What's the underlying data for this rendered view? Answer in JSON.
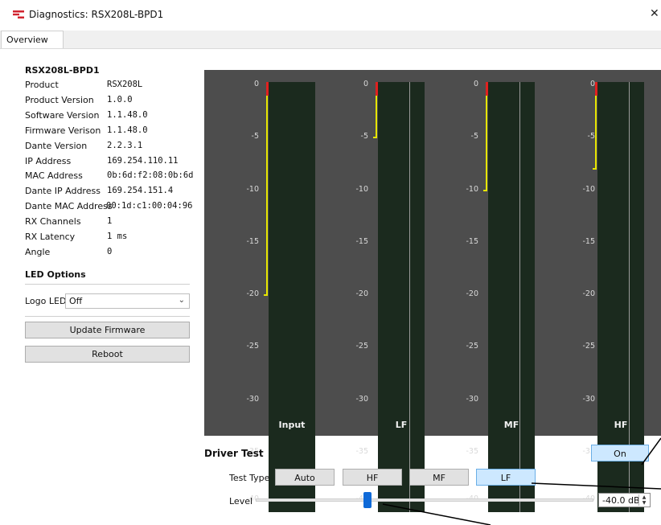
{
  "window": {
    "title": "Diagnostics: RSX208L-BPD1",
    "close_glyph": "✕",
    "accent": "#d1242f"
  },
  "tabs": [
    {
      "label": "Overview"
    }
  ],
  "info": {
    "heading": "RSX208L-BPD1",
    "rows": [
      {
        "label": "Product",
        "value": "RSX208L"
      },
      {
        "label": "Product Version",
        "value": "1.0.0"
      },
      {
        "label": "Software Version",
        "value": "1.1.48.0"
      },
      {
        "label": "Firmware Verison",
        "value": "1.1.48.0"
      },
      {
        "label": "Dante Version",
        "value": "2.2.3.1"
      },
      {
        "label": "IP Address",
        "value": "169.254.110.11"
      },
      {
        "label": "MAC Address",
        "value": "0b:6d:f2:08:0b:6d"
      },
      {
        "label": "Dante IP Address",
        "value": "169.254.151.4"
      },
      {
        "label": "Dante MAC Address",
        "value": "00:1d:c1:00:04:96"
      },
      {
        "label": "RX Channels",
        "value": "1"
      },
      {
        "label": "RX Latency",
        "value": "1 ms"
      },
      {
        "label": "Angle",
        "value": "0"
      }
    ],
    "led_heading": "LED Options",
    "logo_led_label": "Logo LED",
    "logo_led_value": "Off"
  },
  "buttons": {
    "update_firmware": "Update Firmware",
    "reboot": "Reboot"
  },
  "meters": {
    "tick_labels": [
      "0",
      "-5",
      "-10",
      "-15",
      "-20",
      "-25",
      "-30",
      "-35",
      "-40"
    ],
    "channels": [
      {
        "label": "Input",
        "peak_db": -20
      },
      {
        "label": "LF",
        "peak_db": -5
      },
      {
        "label": "MF",
        "peak_db": -10
      },
      {
        "label": "HF",
        "peak_db": -8
      }
    ],
    "colors": {
      "background": "#4d4d4d",
      "bar": "#1b2a1e",
      "level": "#e6e600",
      "clip": "#e02020"
    }
  },
  "driver_test": {
    "title": "Driver Test",
    "on_label": "On",
    "test_type_label": "Test Type",
    "test_types": [
      "Auto",
      "HF",
      "MF",
      "LF"
    ],
    "selected_type": "LF",
    "level_label": "Level",
    "level_value": "-40.0 dB",
    "level_fraction": 0.33
  }
}
